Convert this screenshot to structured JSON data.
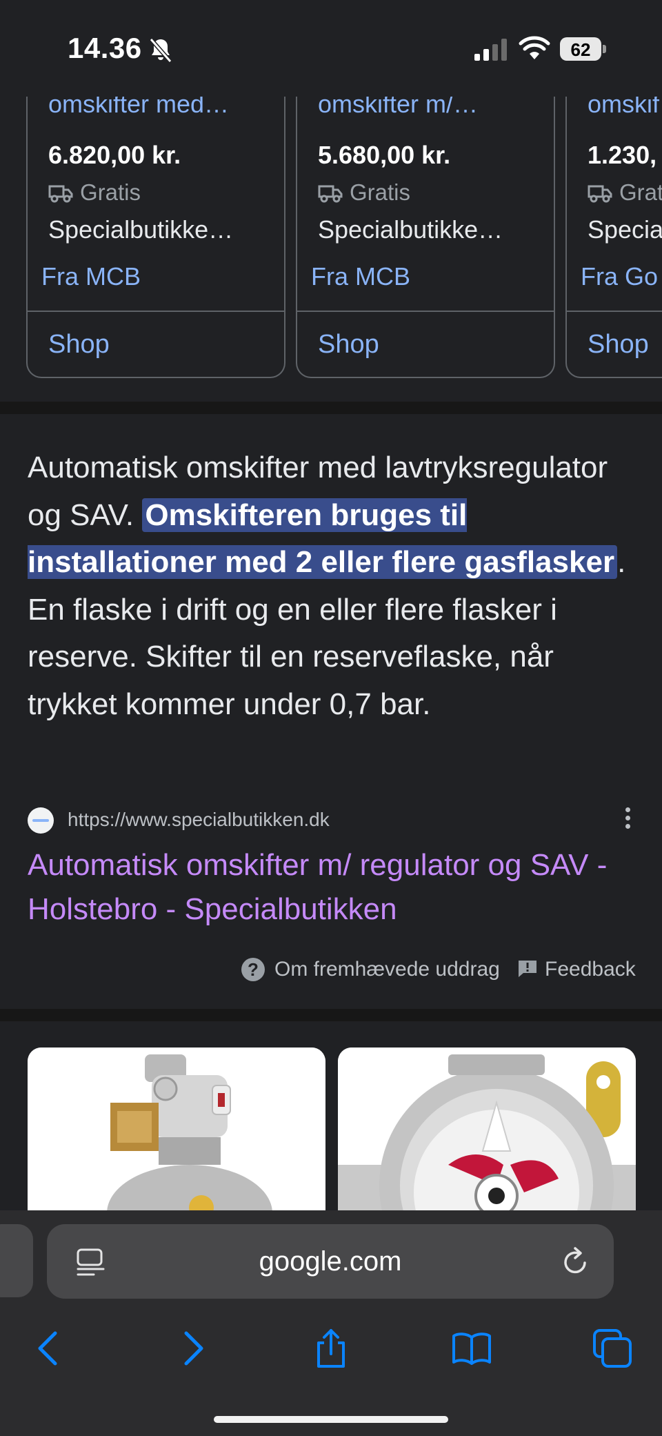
{
  "status_bar": {
    "time": "14.36",
    "battery": "62"
  },
  "product_cards": [
    {
      "title": "omskifter med…",
      "price": "6.820,00 kr.",
      "shipping": "Gratis",
      "seller": "Specialbutikke…",
      "from": "Fra MCB",
      "shop_label": "Shop"
    },
    {
      "title": "omskifter m/…",
      "price": "5.680,00 kr.",
      "shipping": "Gratis",
      "seller": "Specialbutikke…",
      "from": "Fra MCB",
      "shop_label": "Shop"
    },
    {
      "title": "omskif",
      "price": "1.230,",
      "shipping": "Grat",
      "seller": "Specia",
      "from": "Fra Go",
      "shop_label": "Shop"
    }
  ],
  "snippet": {
    "before": "Automatisk omskifter med lavtryksregulator og SAV. ",
    "highlight": "Omskifteren bruges til installationer med 2 eller flere gasflasker",
    "after": ". En flaske i drift og en eller flere flasker i reserve. Skifter til en reserveflaske, når trykket kommer under 0,7 bar."
  },
  "source": {
    "url": "https://www.specialbutikken.dk",
    "title": "Automatisk omskifter m/ regulator og SAV - Holstebro - Specialbutikken"
  },
  "footer": {
    "about_label": "Om fremhævede uddrag",
    "feedback_label": "Feedback"
  },
  "browser": {
    "domain": "google.com"
  }
}
